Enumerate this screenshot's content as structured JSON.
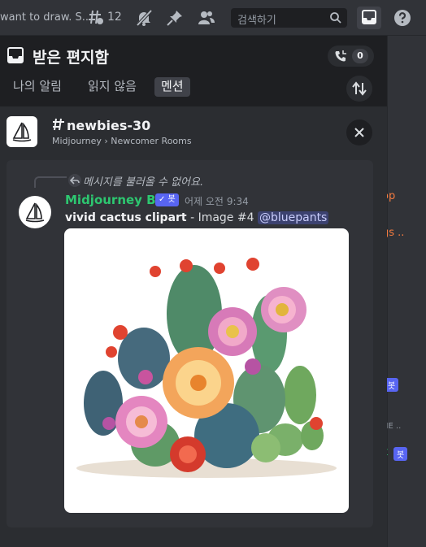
{
  "topbar": {
    "topic": "want to draw. S...",
    "threads_count": "12",
    "search_placeholder": "검색하기"
  },
  "inbox": {
    "title": "받은 편지함",
    "unread_count": "0",
    "tabs": [
      {
        "label": "나의 알림"
      },
      {
        "label": "읽지 않음"
      },
      {
        "label": "멘션"
      }
    ]
  },
  "channel": {
    "name": "newbies-30",
    "server": "Midjourney",
    "separator": "›",
    "category": "Newcomer Rooms"
  },
  "message": {
    "reply_notice": "메시지를 불러올 수 없어요.",
    "author": "Midjourney Bot",
    "bot_tag": "✓ 봇",
    "timestamp_day": "어제 오전",
    "timestamp_time": "9:34",
    "prompt": "vivid cactus clipart",
    "suffix": " - Image #4 ",
    "mention": "@bluepants"
  },
  "background_chat": {
    "snippet1": "op",
    "snippet2": "gs ..",
    "snippet3": "NE ..",
    "snippet4": "t",
    "bot_badge": "봇"
  },
  "colors": {
    "author": "#2dc770",
    "accent": "#5865f2",
    "mention_bg": "#3c4270"
  }
}
